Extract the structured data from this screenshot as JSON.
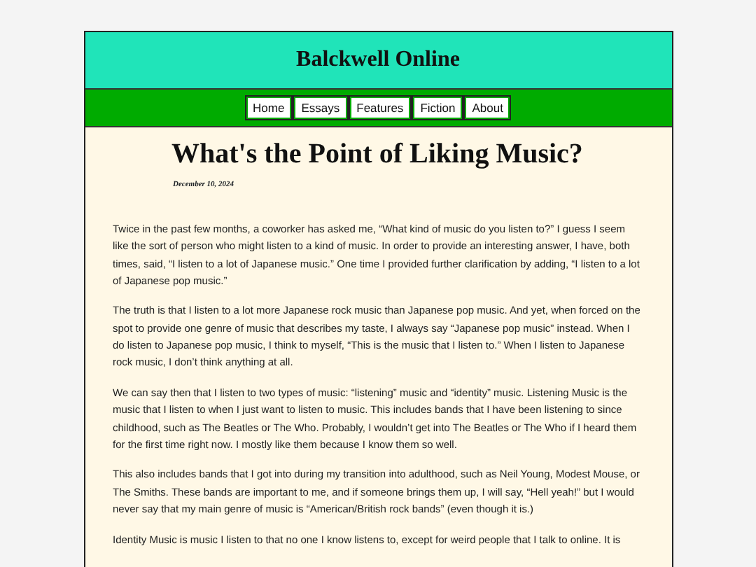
{
  "site_title": "Balckwell Online",
  "nav": [
    {
      "label": "Home"
    },
    {
      "label": "Essays"
    },
    {
      "label": "Features"
    },
    {
      "label": "Fiction"
    },
    {
      "label": "About"
    }
  ],
  "article": {
    "title": "What's the Point of Liking Music?",
    "date": "December 10, 2024",
    "paragraphs": [
      "Twice in the past few months, a coworker has asked me, “What kind of music do you listen to?” I guess I seem like the sort of person who might listen to a kind of music. In order to provide an interesting answer, I have, both times, said, “I listen to a lot of Japanese music.” One time I provided further clarification by adding, “I listen to a lot of Japanese pop music.”",
      "The truth is that I listen to a lot more Japanese rock music than Japanese pop music. And yet, when forced on the spot to provide one genre of music that describes my taste, I always say “Japanese pop music” instead. When I do listen to Japanese pop music, I think to myself, “This is the music that I listen to.” When I listen to Japanese rock music, I don’t think anything at all.",
      "We can say then that I listen to two types of music: “listening” music and “identity” music. Listening Music is the music that I listen to when I just want to listen to music. This includes bands that I have been listening to since childhood, such as The Beatles or The Who. Probably, I wouldn’t get into The Beatles or The Who if I heard them for the first time right now. I mostly like them because I know them so well.",
      "This also includes bands that I got into during my transition into adulthood, such as Neil Young, Modest Mouse, or The Smiths. These bands are important to me, and if someone brings them up, I will say, “Hell yeah!” but I would never say that my main genre of music is “American/British rock bands” (even though it is.)",
      "Identity Music is music I listen to that no one I know listens to, except for weird people that I talk to online. It is"
    ]
  }
}
